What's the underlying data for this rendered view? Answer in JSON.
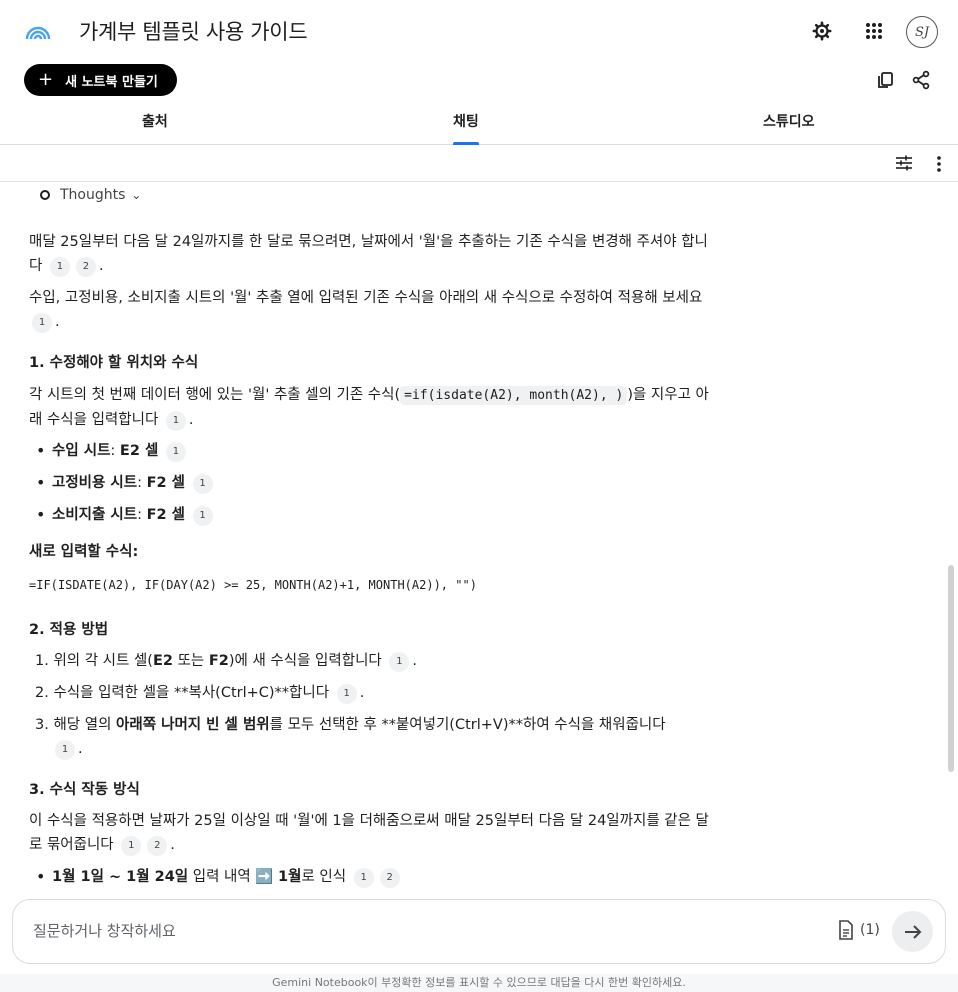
{
  "header": {
    "title": "가계부 템플릿 사용 가이드",
    "avatar_text": "SJ",
    "new_notebook_label": "새 노트북 만들기"
  },
  "tabs": [
    {
      "label": "출처"
    },
    {
      "label": "채팅",
      "active": true
    },
    {
      "label": "스튜디오"
    }
  ],
  "thoughts_label": "Thoughts",
  "message": {
    "p1_text": "매달 25일부터 다음 달 24일까지를 한 달로 묶으려면, 날짜에서 '월'을 추출하는 기존 수식을 변경해 주셔야 합니다",
    "p1_cites": [
      "1",
      "2"
    ],
    "p2_text": "수입, 고정비용, 소비지출 시트의 '월' 추출 열에 입력된 기존 수식을 아래의 새 수식으로 수정하여 적용해 보세요",
    "p2_cites": [
      "1"
    ],
    "h1": "1. 수정해야 할 위치와 수식",
    "p3_before": "각 시트의 첫 번째 데이터 행에 있는 '월' 추출 셀의 기존 수식(",
    "p3_code": "=if(isdate(A2), month(A2), )",
    "p3_after": ")을 지우고 아래 수식을 입력합니다",
    "p3_cites": [
      "1"
    ],
    "bullets1": [
      {
        "bold": "수입 시트",
        "sep": ": ",
        "bold2": "E2 셀",
        "cite": "1"
      },
      {
        "bold": "고정비용 시트",
        "sep": ": ",
        "bold2": "F2 셀",
        "cite": "1"
      },
      {
        "bold": "소비지출 시트",
        "sep": ": ",
        "bold2": "F2 셀",
        "cite": "1"
      }
    ],
    "formula_heading": "새로 입력할 수식:",
    "formula": "=IF(ISDATE(A2), IF(DAY(A2) >= 25, MONTH(A2)+1, MONTH(A2)), \"\")",
    "h2": "2. 적용 방법",
    "steps": {
      "s1_a": "1. 위의 각 시트 셀(",
      "s1_b1": "E2",
      "s1_c": " 또는 ",
      "s1_b2": "F2",
      "s1_d": ")에 새 수식을 입력합니다",
      "s1_cite": "1",
      "s2": "2. 수식을 입력한 셀을 **복사(Ctrl+C)**합니다",
      "s2_cite": "1",
      "s3_a": "3. 해당 열의 ",
      "s3_b": "아래쪽 나머지 빈 셀 범위",
      "s3_c": "를 모두 선택한 후 **붙여넣기(Ctrl+V)**하여 수식을 채워줍니다",
      "s3_cite": "1"
    },
    "h3": "3. 수식 작동 방식",
    "p4_text": "이 수식을 적용하면 날짜가 25일 이상일 때 '월'에 1을 더해줌으로써 매달 25일부터 다음 달 24일까지를 같은 달로 묶어줍니다",
    "p4_cites": [
      "1",
      "2"
    ],
    "last_bullet": {
      "bold": "1월 1일 ~ 1월 24일",
      "mid": " 입력 내역 ",
      "arrow": "➡️",
      "bold2": "1월",
      "tail": "로 인식",
      "cites": [
        "1",
        "2"
      ]
    }
  },
  "composer": {
    "placeholder": "질문하거나 창작하세요",
    "source_count": "(1)"
  },
  "footer_text": "Gemini Notebook이 부정확한 정보를 표시할 수 있으므로 대답을 다시 한번 확인하세요.",
  "colors": {
    "accent": "#1a73e8",
    "button_bg": "#000000"
  }
}
